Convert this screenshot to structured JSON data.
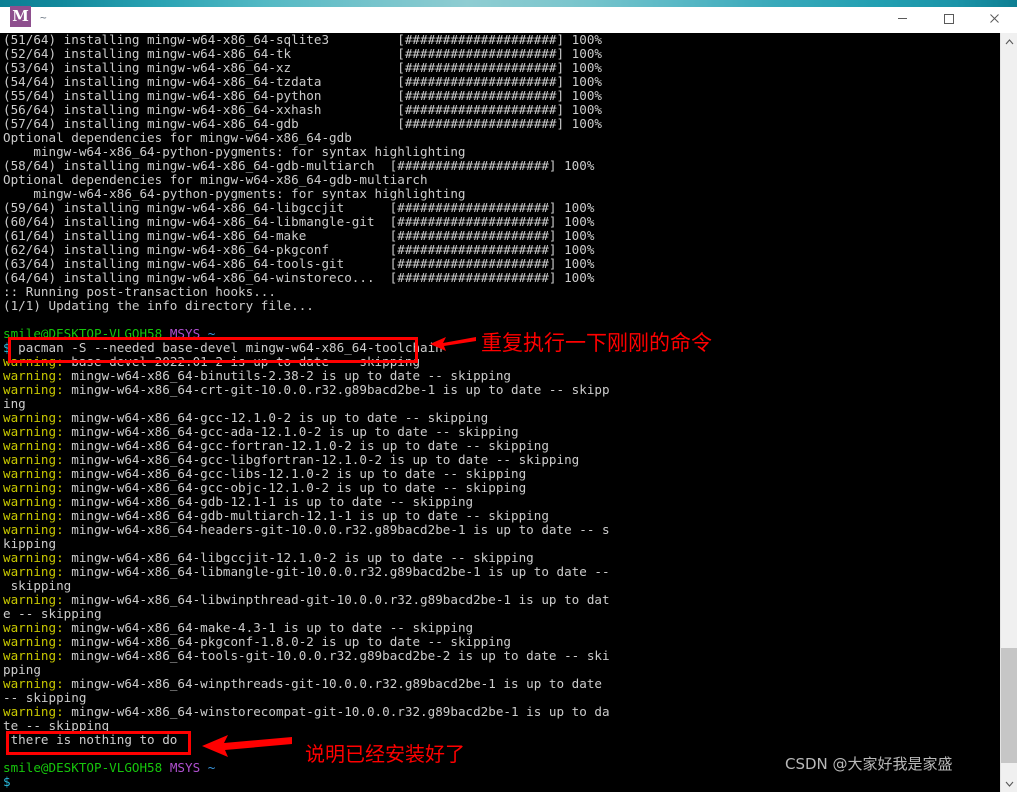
{
  "window": {
    "title": "~",
    "icon_letter": "M",
    "minimize_label": "—",
    "maximize_label": "□",
    "close_label": "×"
  },
  "terminal": {
    "lines": [
      {
        "segments": [
          {
            "text": "(51/64) installing mingw-w64-x86_64-sqlite3         [####################] 100%",
            "color": "white"
          }
        ]
      },
      {
        "segments": [
          {
            "text": "(52/64) installing mingw-w64-x86_64-tk              [####################] 100%",
            "color": "white"
          }
        ]
      },
      {
        "segments": [
          {
            "text": "(53/64) installing mingw-w64-x86_64-xz              [####################] 100%",
            "color": "white"
          }
        ]
      },
      {
        "segments": [
          {
            "text": "(54/64) installing mingw-w64-x86_64-tzdata          [####################] 100%",
            "color": "white"
          }
        ]
      },
      {
        "segments": [
          {
            "text": "(55/64) installing mingw-w64-x86_64-python          [####################] 100%",
            "color": "white"
          }
        ]
      },
      {
        "segments": [
          {
            "text": "(56/64) installing mingw-w64-x86_64-xxhash          [####################] 100%",
            "color": "white"
          }
        ]
      },
      {
        "segments": [
          {
            "text": "(57/64) installing mingw-w64-x86_64-gdb             [####################] 100%",
            "color": "white"
          }
        ]
      },
      {
        "segments": [
          {
            "text": "Optional dependencies for mingw-w64-x86_64-gdb",
            "color": "white"
          }
        ]
      },
      {
        "segments": [
          {
            "text": "    mingw-w64-x86_64-python-pygments: for syntax highlighting",
            "color": "white"
          }
        ]
      },
      {
        "segments": [
          {
            "text": "(58/64) installing mingw-w64-x86_64-gdb-multiarch  [####################] 100%",
            "color": "white"
          }
        ]
      },
      {
        "segments": [
          {
            "text": "Optional dependencies for mingw-w64-x86_64-gdb-multiarch",
            "color": "white"
          }
        ]
      },
      {
        "segments": [
          {
            "text": "    mingw-w64-x86_64-python-pygments: for syntax highlighting",
            "color": "white"
          }
        ]
      },
      {
        "segments": [
          {
            "text": "(59/64) installing mingw-w64-x86_64-libgccjit      [####################] 100%",
            "color": "white"
          }
        ]
      },
      {
        "segments": [
          {
            "text": "(60/64) installing mingw-w64-x86_64-libmangle-git  [####################] 100%",
            "color": "white"
          }
        ]
      },
      {
        "segments": [
          {
            "text": "(61/64) installing mingw-w64-x86_64-make           [####################] 100%",
            "color": "white"
          }
        ]
      },
      {
        "segments": [
          {
            "text": "(62/64) installing mingw-w64-x86_64-pkgconf        [####################] 100%",
            "color": "white"
          }
        ]
      },
      {
        "segments": [
          {
            "text": "(63/64) installing mingw-w64-x86_64-tools-git      [####################] 100%",
            "color": "white"
          }
        ]
      },
      {
        "segments": [
          {
            "text": "(64/64) installing mingw-w64-x86_64-winstoreco...  [####################] 100%",
            "color": "white"
          }
        ]
      },
      {
        "segments": [
          {
            "text": ":: Running post-transaction hooks...",
            "color": "white"
          }
        ]
      },
      {
        "segments": [
          {
            "text": "(1/1) Updating the info directory file...",
            "color": "white"
          }
        ]
      },
      {
        "segments": [
          {
            "text": "",
            "color": "white"
          }
        ]
      },
      {
        "segments": [
          {
            "text": "smile@DESKTOP-VLGOH58",
            "color": "green"
          },
          {
            "text": " ",
            "color": "white"
          },
          {
            "text": "MSYS",
            "color": "purple"
          },
          {
            "text": " ",
            "color": "white"
          },
          {
            "text": "~",
            "color": "cyan"
          }
        ]
      },
      {
        "segments": [
          {
            "text": "$ ",
            "color": "teal"
          },
          {
            "text": "pacman -S --needed base-devel mingw-w64-x86_64-toolchain",
            "color": "white"
          }
        ]
      },
      {
        "segments": [
          {
            "text": "warning:",
            "color": "warn"
          },
          {
            "text": " base-devel-2022.01-2 is up to date -- skipping",
            "color": "white"
          }
        ]
      },
      {
        "segments": [
          {
            "text": "warning:",
            "color": "warn"
          },
          {
            "text": " mingw-w64-x86_64-binutils-2.38-2 is up to date -- skipping",
            "color": "white"
          }
        ]
      },
      {
        "segments": [
          {
            "text": "warning:",
            "color": "warn"
          },
          {
            "text": " mingw-w64-x86_64-crt-git-10.0.0.r32.g89bacd2be-1 is up to date -- skipp",
            "color": "white"
          }
        ]
      },
      {
        "segments": [
          {
            "text": "ing",
            "color": "white"
          }
        ]
      },
      {
        "segments": [
          {
            "text": "warning:",
            "color": "warn"
          },
          {
            "text": " mingw-w64-x86_64-gcc-12.1.0-2 is up to date -- skipping",
            "color": "white"
          }
        ]
      },
      {
        "segments": [
          {
            "text": "warning:",
            "color": "warn"
          },
          {
            "text": " mingw-w64-x86_64-gcc-ada-12.1.0-2 is up to date -- skipping",
            "color": "white"
          }
        ]
      },
      {
        "segments": [
          {
            "text": "warning:",
            "color": "warn"
          },
          {
            "text": " mingw-w64-x86_64-gcc-fortran-12.1.0-2 is up to date -- skipping",
            "color": "white"
          }
        ]
      },
      {
        "segments": [
          {
            "text": "warning:",
            "color": "warn"
          },
          {
            "text": " mingw-w64-x86_64-gcc-libgfortran-12.1.0-2 is up to date -- skipping",
            "color": "white"
          }
        ]
      },
      {
        "segments": [
          {
            "text": "warning:",
            "color": "warn"
          },
          {
            "text": " mingw-w64-x86_64-gcc-libs-12.1.0-2 is up to date -- skipping",
            "color": "white"
          }
        ]
      },
      {
        "segments": [
          {
            "text": "warning:",
            "color": "warn"
          },
          {
            "text": " mingw-w64-x86_64-gcc-objc-12.1.0-2 is up to date -- skipping",
            "color": "white"
          }
        ]
      },
      {
        "segments": [
          {
            "text": "warning:",
            "color": "warn"
          },
          {
            "text": " mingw-w64-x86_64-gdb-12.1-1 is up to date -- skipping",
            "color": "white"
          }
        ]
      },
      {
        "segments": [
          {
            "text": "warning:",
            "color": "warn"
          },
          {
            "text": " mingw-w64-x86_64-gdb-multiarch-12.1-1 is up to date -- skipping",
            "color": "white"
          }
        ]
      },
      {
        "segments": [
          {
            "text": "warning:",
            "color": "warn"
          },
          {
            "text": " mingw-w64-x86_64-headers-git-10.0.0.r32.g89bacd2be-1 is up to date -- s",
            "color": "white"
          }
        ]
      },
      {
        "segments": [
          {
            "text": "kipping",
            "color": "white"
          }
        ]
      },
      {
        "segments": [
          {
            "text": "warning:",
            "color": "warn"
          },
          {
            "text": " mingw-w64-x86_64-libgccjit-12.1.0-2 is up to date -- skipping",
            "color": "white"
          }
        ]
      },
      {
        "segments": [
          {
            "text": "warning:",
            "color": "warn"
          },
          {
            "text": " mingw-w64-x86_64-libmangle-git-10.0.0.r32.g89bacd2be-1 is up to date --",
            "color": "white"
          }
        ]
      },
      {
        "segments": [
          {
            "text": " skipping",
            "color": "white"
          }
        ]
      },
      {
        "segments": [
          {
            "text": "warning:",
            "color": "warn"
          },
          {
            "text": " mingw-w64-x86_64-libwinpthread-git-10.0.0.r32.g89bacd2be-1 is up to dat",
            "color": "white"
          }
        ]
      },
      {
        "segments": [
          {
            "text": "e -- skipping",
            "color": "white"
          }
        ]
      },
      {
        "segments": [
          {
            "text": "warning:",
            "color": "warn"
          },
          {
            "text": " mingw-w64-x86_64-make-4.3-1 is up to date -- skipping",
            "color": "white"
          }
        ]
      },
      {
        "segments": [
          {
            "text": "warning:",
            "color": "warn"
          },
          {
            "text": " mingw-w64-x86_64-pkgconf-1.8.0-2 is up to date -- skipping",
            "color": "white"
          }
        ]
      },
      {
        "segments": [
          {
            "text": "warning:",
            "color": "warn"
          },
          {
            "text": " mingw-w64-x86_64-tools-git-10.0.0.r32.g89bacd2be-2 is up to date -- ski",
            "color": "white"
          }
        ]
      },
      {
        "segments": [
          {
            "text": "pping",
            "color": "white"
          }
        ]
      },
      {
        "segments": [
          {
            "text": "warning:",
            "color": "warn"
          },
          {
            "text": " mingw-w64-x86_64-winpthreads-git-10.0.0.r32.g89bacd2be-1 is up to date",
            "color": "white"
          }
        ]
      },
      {
        "segments": [
          {
            "text": "-- skipping",
            "color": "white"
          }
        ]
      },
      {
        "segments": [
          {
            "text": "warning:",
            "color": "warn"
          },
          {
            "text": " mingw-w64-x86_64-winstorecompat-git-10.0.0.r32.g89bacd2be-1 is up to da",
            "color": "white"
          }
        ]
      },
      {
        "segments": [
          {
            "text": "te -- skipping",
            "color": "white"
          }
        ]
      },
      {
        "segments": [
          {
            "text": " there is nothing to do",
            "color": "white"
          }
        ]
      },
      {
        "segments": [
          {
            "text": "",
            "color": "white"
          }
        ]
      },
      {
        "segments": [
          {
            "text": "smile@DESKTOP-VLGOH58",
            "color": "green"
          },
          {
            "text": " ",
            "color": "white"
          },
          {
            "text": "MSYS",
            "color": "purple"
          },
          {
            "text": " ",
            "color": "white"
          },
          {
            "text": "~",
            "color": "cyan"
          }
        ]
      },
      {
        "segments": [
          {
            "text": "$",
            "color": "teal"
          }
        ]
      }
    ]
  },
  "annotations": {
    "accent_color": "#ff0000",
    "top_note": "重复执行一下刚刚的命令",
    "bottom_note": "说明已经安装好了",
    "highlighted_command": "pacman -S --needed base-devel mingw-w64-x86_64-toolchain",
    "highlighted_result": "there is nothing to do"
  },
  "watermark": {
    "text": "CSDN @大家好我是家盛"
  }
}
